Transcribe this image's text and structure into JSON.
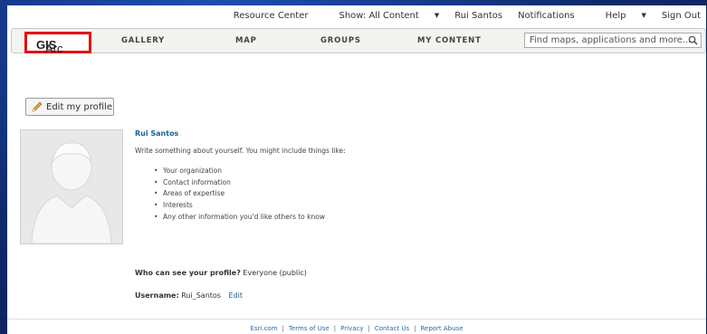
{
  "topbar": {
    "resource_center": "Resource Center",
    "show_content": "Show: All Content",
    "user": "Rui Santos",
    "notifications": "Notifications",
    "help": "Help",
    "sign_out": "Sign Out"
  },
  "nav": {
    "brand_a": "Arc",
    "brand_b": "GIS",
    "items": [
      "GALLERY",
      "MAP",
      "GROUPS",
      "MY CONTENT"
    ],
    "search_placeholder": "Find maps, applications and more..."
  },
  "profile": {
    "edit_button": "Edit my profile",
    "name": "Rui Santos",
    "description": "Write something about yourself. You might include things like:",
    "suggestions": [
      "Your organization",
      "Contact information",
      "Areas of expertise",
      "Interests",
      "Any other information you'd like others to know"
    ],
    "visibility_label": "Who can see your profile?",
    "visibility_value": "Everyone (public)",
    "username_label": "Username:",
    "username_value": "Rui_Santos",
    "username_edit": "Edit"
  },
  "footer": {
    "links": [
      "Esri.com",
      "Terms of Use",
      "Privacy",
      "Contact Us",
      "Report Abuse"
    ]
  },
  "colors": {
    "highlight": "#e41111",
    "link": "#1a6196",
    "background": "#0f2a6b"
  }
}
